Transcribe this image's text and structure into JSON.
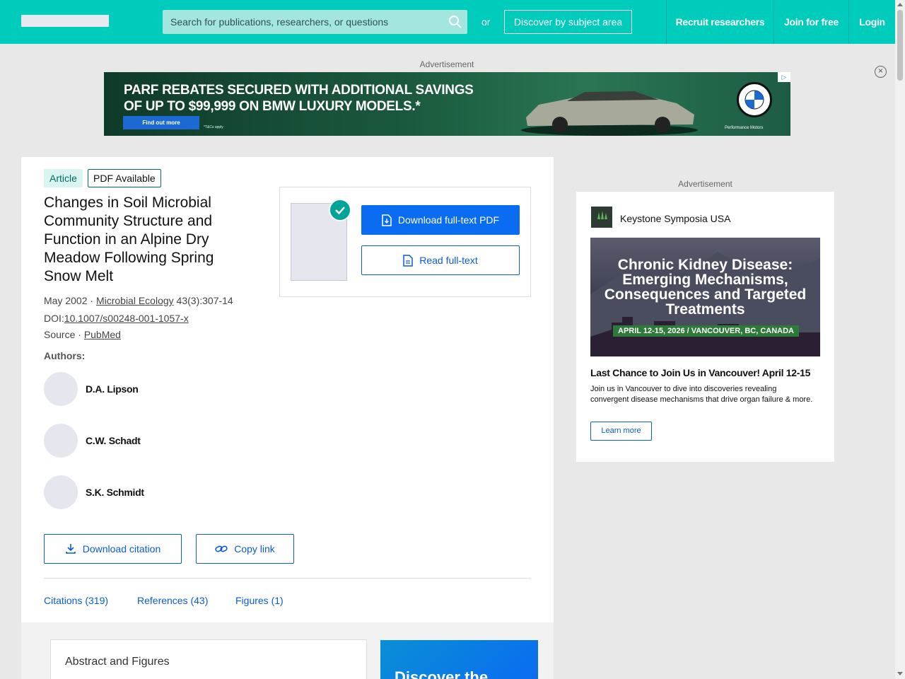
{
  "header": {
    "search_placeholder": "Search for publications, researchers, or questions",
    "or_text": "or",
    "discover_label": "Discover by subject area",
    "nav": [
      "Recruit researchers",
      "Join for free",
      "Login"
    ]
  },
  "top_ad": {
    "label": "Advertisement",
    "headline": "PARF REBATES SECURED WITH ADDITIONAL SAVINGS OF UP TO $99,999 ON BMW LUXURY MODELS.*",
    "cta": "Find out more",
    "fineprint": "*T&Cs apply",
    "dealer": "Performance Motors"
  },
  "article": {
    "type_badge": "Article",
    "pdf_badge": "PDF Available",
    "title": "Changes in Soil Microbial Community Structure and Function in an Alpine Dry Meadow Following Spring Snow Melt",
    "date": "May 2002 · ",
    "journal": "Microbial Ecology",
    "volume": " 43(3):307-14",
    "doi_label": "DOI:",
    "doi": "10.1007/s00248-001-1057-x",
    "source_label": "Source · ",
    "source": "PubMed",
    "authors_label": "Authors:",
    "authors": [
      "D.A. Lipson",
      "C.W. Schadt",
      "S.K. Schmidt"
    ],
    "download_citation": "Download citation",
    "copy_link": "Copy link",
    "tabs": [
      "Citations (319)",
      "References (43)",
      "Figures (1)"
    ],
    "download_pdf": "Download full-text PDF",
    "read_fulltext": "Read full-text",
    "abstract_heading": "Abstract and Figures",
    "promo_text": "Discover the"
  },
  "side_ad": {
    "label": "Advertisement",
    "brand": "Keystone Symposia USA",
    "image_headline": "Chronic Kidney Disease: Emerging Mechanisms, Consequences and Targeted Treatments",
    "image_date": "APRIL 12-15, 2026 / VANCOUVER, BC, CANADA",
    "heading": "Last Chance to Join Us in Vancouver! April 12-15",
    "body": "Join us in Vancouver to dive into discoveries revealing convergent disease mechanisms that drive organ failure & more.",
    "cta": "Learn more"
  },
  "colors": {
    "brand_teal": "#00ccbb",
    "link_blue": "#0a5bd6",
    "primary_button": "#0a6cf0"
  }
}
